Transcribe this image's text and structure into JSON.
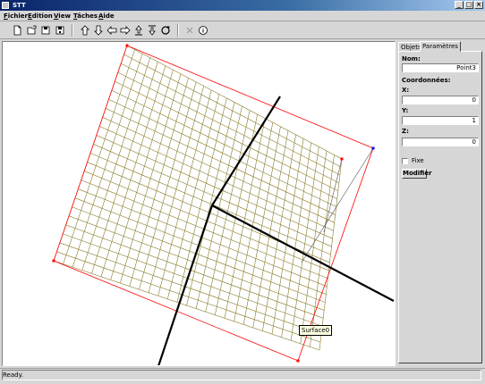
{
  "window": {
    "title": "STT"
  },
  "menu": [
    {
      "mnemonic": "F",
      "rest": "ichier"
    },
    {
      "mnemonic": "E",
      "rest": "dition"
    },
    {
      "mnemonic": "V",
      "rest": "iew"
    },
    {
      "mnemonic": "T",
      "rest": "âches"
    },
    {
      "mnemonic": "A",
      "rest": "ide"
    }
  ],
  "toolbar": {
    "icons": [
      "new-file-icon",
      "open-file-icon",
      "save-icon",
      "save-as-icon",
      "arrow-up-icon",
      "arrow-down-icon",
      "arrow-left-icon",
      "arrow-right-icon",
      "move-up-icon",
      "move-down-icon",
      "rotate-icon",
      "delete-icon",
      "info-icon"
    ]
  },
  "canvas": {
    "tooltip": "Surface0",
    "colors": {
      "grid": "#8a7a2a",
      "frame": "#ff0000",
      "axes": "#000000",
      "point": "#0000ff"
    }
  },
  "panel": {
    "tabs": [
      "Objets",
      "Paramètres"
    ],
    "active_tab": "Paramètres",
    "nom_label": "Nom:",
    "nom_value": "Point3",
    "coords_label": "Coordonnées:",
    "x_label": "X:",
    "x_value": "0",
    "y_label": "Y:",
    "y_value": "1",
    "z_label": "Z:",
    "z_value": "0",
    "fixe_label": "Fixe",
    "fixe_checked": false,
    "modifier_label": "Modifier"
  },
  "status": {
    "text": "Ready."
  }
}
